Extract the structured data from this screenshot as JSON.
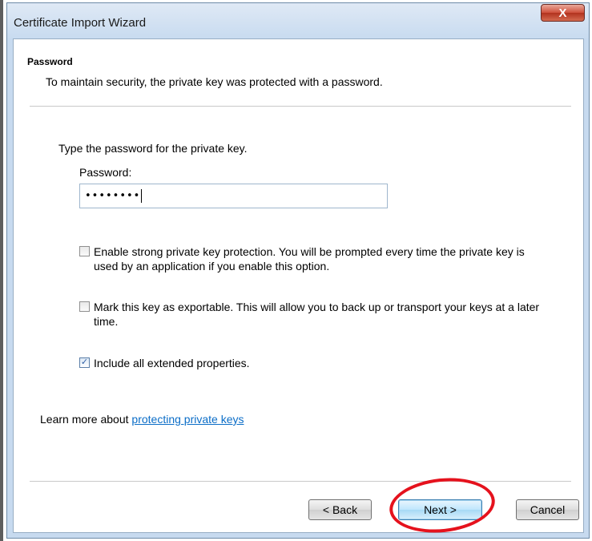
{
  "window": {
    "title": "Certificate Import Wizard",
    "close_label": "X"
  },
  "header": {
    "title": "Password",
    "subtitle": "To maintain security, the private key was protected with a password."
  },
  "form": {
    "prompt": "Type the password for the private key.",
    "password_label": "Password:",
    "password_value": "••••••••"
  },
  "options": [
    {
      "label": "Enable strong private key protection. You will be prompted every time the private key is used by an application if you enable this option.",
      "checked": false
    },
    {
      "label": "Mark this key as exportable. This will allow you to back up or transport your keys at a later time.",
      "checked": false
    },
    {
      "label": "Include all extended properties.",
      "checked": true
    }
  ],
  "learn_more": {
    "prefix": "Learn more about ",
    "link_text": "protecting private keys"
  },
  "buttons": {
    "back": "< Back",
    "next": "Next >",
    "cancel": "Cancel"
  },
  "colors": {
    "annotation": "#e5121d",
    "link": "#0b6dc7"
  }
}
